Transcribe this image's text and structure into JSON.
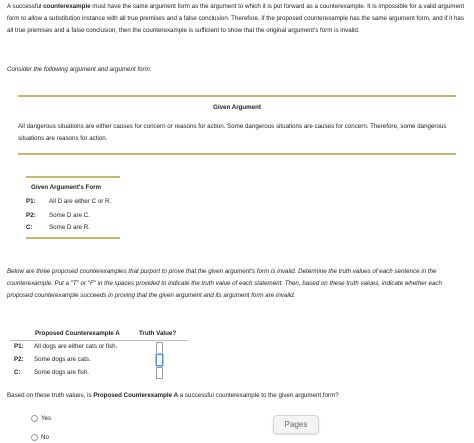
{
  "intro": {
    "prefix": "A successful ",
    "term": "counterexample",
    "rest": " must have the same argument form as the argument to which it is put forward as a counterexample. It is impossible for a valid argument form to allow a substitution instance with all true premises and a false conclusion. Therefore, if the proposed counterexample has the same argument form, and if it has all true premises and a false conclusion, then the counterexample is sufficient to show that the original argument's form is invalid."
  },
  "consider": "Consider the following argument and argument form:",
  "given_argument": {
    "title": "Given Argument",
    "text": "All dangerous situations are either causes for concern or reasons for action. Some dangerous situations are causes for concern. Therefore, some dangerous situations are reasons for action."
  },
  "argument_form": {
    "title": "Given Argument's Form",
    "rows": [
      {
        "label": "P1:",
        "text": "All D are either C or R."
      },
      {
        "label": "P2:",
        "text": "Some D are C."
      },
      {
        "label": "C:",
        "text": "Some D are R."
      }
    ]
  },
  "instructions": "Below are three proposed counterexamples that purport to prove that the given argument's form is invalid. Determine the truth values of each sentence in the counterexample. Put a \"T\" or \"F\" in the spaces provided to indicate the truth value of each statement. Then, based on these truth values, indicate whether each proposed counterexample succeeds in proving that the given argument and its argument form are invalid.",
  "counterexample": {
    "header": "Proposed Counterexample A",
    "truth_header": "Truth Value?",
    "rows": [
      {
        "label": "P1:",
        "text": "All dogs are either cats or fish.",
        "value": ""
      },
      {
        "label": "P2:",
        "text": "Some dogs are cats.",
        "value": ""
      },
      {
        "label": "C:",
        "text": "Some dogs are fish.",
        "value": ""
      }
    ]
  },
  "question": {
    "prefix": "Based on these truth values, is ",
    "term": "Proposed Counterexample A",
    "suffix": " a successful counterexample to the given argument form?"
  },
  "options": [
    "Yes",
    "No"
  ],
  "pages_button": "Pages",
  "colors": {
    "rule": "#c8b96a",
    "focus": "#4a90d9"
  }
}
